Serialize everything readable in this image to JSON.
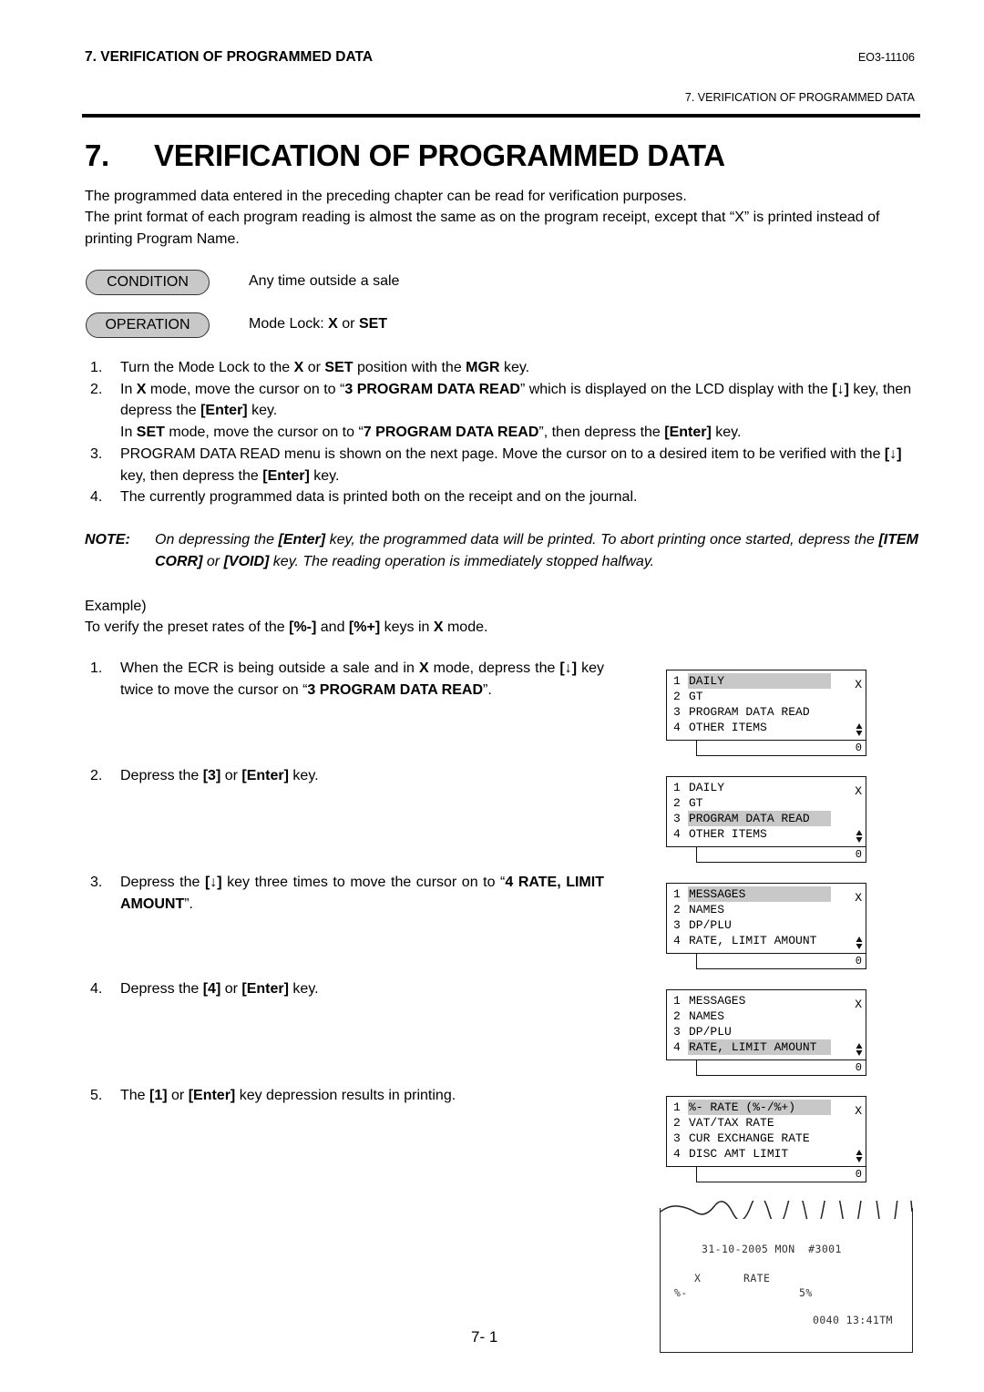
{
  "header": {
    "section": "7. VERIFICATION OF PROGRAMMED DATA",
    "doc_code": "EO3-11106",
    "sub_section": "7. VERIFICATION OF PROGRAMMED DATA"
  },
  "title": {
    "number": "7.",
    "text": "VERIFICATION OF PROGRAMMED DATA"
  },
  "intro": [
    "The programmed data entered in the preceding chapter can be read for verification purposes.",
    "The print format of each program reading is almost the same as on the program receipt, except that “X” is printed instead of printing Program Name."
  ],
  "condition": {
    "label": "CONDITION",
    "text": "Any time outside a sale"
  },
  "operation": {
    "label": "OPERATION",
    "text_prefix": "Mode Lock: ",
    "x": "X",
    "or": " or ",
    "set": "SET"
  },
  "steps": [
    {
      "n": "1.",
      "html_parts": [
        "Turn the Mode Lock to the ",
        "b:X",
        " or ",
        "b:SET",
        " position with the ",
        "b:MGR",
        " key."
      ]
    },
    {
      "n": "2.",
      "html_parts": [
        "In ",
        "b:X",
        " mode, move the cursor on to “",
        "b:3 PROGRAM DATA READ",
        "” which is displayed on the LCD display with the ",
        "b:[↓]",
        " key, then depress the ",
        "b:[Enter]",
        " key.",
        "br",
        "In ",
        "b:SET",
        " mode, move the cursor on to “",
        "b:7 PROGRAM DATA READ",
        "”, then depress the ",
        "b:[Enter]",
        " key."
      ]
    },
    {
      "n": "3.",
      "html_parts": [
        "PROGRAM DATA READ menu is shown on the next page.  Move the cursor on to a desired item to be verified with the ",
        "b:[↓]",
        " key, then depress the ",
        "b:[Enter]",
        " key."
      ]
    },
    {
      "n": "4.",
      "html_parts": [
        "The currently programmed data is printed both on the receipt and on the journal."
      ]
    }
  ],
  "note": {
    "label": "NOTE:",
    "html_parts": [
      "On depressing the ",
      "b:[Enter]",
      " key, the programmed data will be printed.  To abort printing once started, depress the ",
      "b:[ITEM CORR]",
      " or ",
      "b:[VOID]",
      " key.  The reading operation is immediately stopped halfway."
    ]
  },
  "example": {
    "label": "Example)",
    "intro_parts": [
      "To verify the preset rates of the ",
      "b:[%-]",
      " and ",
      "b:[%+]",
      " keys in ",
      "b:X",
      " mode."
    ],
    "steps": [
      {
        "n": "1.",
        "html_parts": [
          "When the ECR is being outside a sale and in ",
          "b:X",
          " mode, depress the ",
          "b:[↓]",
          " key twice to move the cursor on “",
          "b:3 PROGRAM DATA READ",
          "”."
        ]
      },
      {
        "n": "2.",
        "html_parts": [
          "Depress the ",
          "b:[3]",
          " or ",
          "b:[Enter]",
          " key."
        ]
      },
      {
        "n": "3.",
        "html_parts": [
          "Depress the ",
          "b:[↓]",
          " key three times to move the cursor on to “",
          "b:4 RATE, LIMIT AMOUNT",
          "”."
        ]
      },
      {
        "n": "4.",
        "html_parts": [
          "Depress the ",
          "b:[4]",
          " or ",
          "b:[Enter]",
          " key."
        ]
      },
      {
        "n": "5.",
        "html_parts": [
          "The ",
          "b:[1]",
          " or ",
          "b:[Enter]",
          " key depression results in printing."
        ]
      }
    ]
  },
  "lcd_screens": [
    {
      "mode": "X",
      "amount": "0",
      "cursor": 1,
      "items": [
        {
          "n": "1",
          "label": "DAILY"
        },
        {
          "n": "2",
          "label": "GT"
        },
        {
          "n": "3",
          "label": "PROGRAM DATA READ"
        },
        {
          "n": "4",
          "label": "OTHER ITEMS"
        }
      ]
    },
    {
      "mode": "X",
      "amount": "0",
      "cursor": 3,
      "items": [
        {
          "n": "1",
          "label": "DAILY"
        },
        {
          "n": "2",
          "label": "GT"
        },
        {
          "n": "3",
          "label": "PROGRAM DATA READ"
        },
        {
          "n": "4",
          "label": "OTHER ITEMS"
        }
      ]
    },
    {
      "mode": "X",
      "amount": "0",
      "cursor": 1,
      "items": [
        {
          "n": "1",
          "label": "MESSAGES"
        },
        {
          "n": "2",
          "label": "NAMES"
        },
        {
          "n": "3",
          "label": "DP/PLU"
        },
        {
          "n": "4",
          "label": "RATE, LIMIT AMOUNT"
        }
      ]
    },
    {
      "mode": "X",
      "amount": "0",
      "cursor": 4,
      "items": [
        {
          "n": "1",
          "label": "MESSAGES"
        },
        {
          "n": "2",
          "label": "NAMES"
        },
        {
          "n": "3",
          "label": "DP/PLU"
        },
        {
          "n": "4",
          "label": "RATE, LIMIT AMOUNT"
        }
      ]
    },
    {
      "mode": "X",
      "amount": "0",
      "cursor": 1,
      "items": [
        {
          "n": "1",
          "label": "%- RATE (%-/%+)"
        },
        {
          "n": "2",
          "label": "VAT/TAX RATE"
        },
        {
          "n": "3",
          "label": "CUR EXCHANGE RATE"
        },
        {
          "n": "4",
          "label": "DISC AMT LIMIT"
        }
      ]
    }
  ],
  "receipt": {
    "date_line": "31-10-2005 MON  #3001",
    "mode": "X",
    "heading": "RATE",
    "item_label": "%-",
    "item_value": "5%",
    "footer": "0040 13:41TM"
  },
  "page_number": "7- 1"
}
